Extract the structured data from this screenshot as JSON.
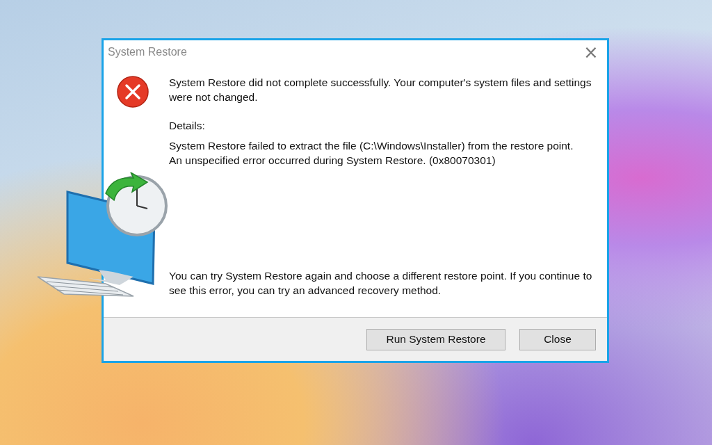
{
  "window": {
    "title": "System Restore",
    "close_glyph": "×"
  },
  "message": {
    "headline": "System Restore did not complete successfully. Your computer's system files and settings were not changed.",
    "details_label": "Details:",
    "details": [
      "System Restore failed to extract the file (C:\\Windows\\Installer) from the restore point.",
      "An unspecified error occurred during System Restore. (0x80070301)"
    ],
    "advice": "You can try System Restore again and choose a different restore point. If you continue to see this error, you can try an advanced recovery method."
  },
  "buttons": [
    {
      "label": "Run System Restore",
      "kind": "wide"
    },
    {
      "label": "Close",
      "kind": "normal"
    }
  ]
}
